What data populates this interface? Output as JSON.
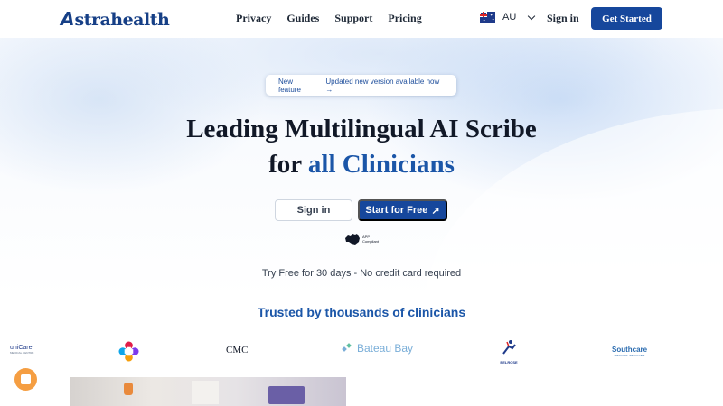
{
  "nav": {
    "logo_mark": "A",
    "logo_text": "stra",
    "logo_text_bold": "health",
    "links": [
      "Privacy",
      "Guides",
      "Support",
      "Pricing"
    ],
    "locale": "AU",
    "signin": "Sign in",
    "cta": "Get Started"
  },
  "announcement": {
    "tag": "New feature",
    "message": "Updated new version available now →"
  },
  "hero": {
    "line1": "Leading Multilingual AI Scribe",
    "line2_prefix": "for ",
    "line2_accent": "all Clinicians",
    "signin_button": "Sign in",
    "start_button": "Start for Free",
    "start_icon": "↗",
    "app_badge_line1": "APP",
    "app_badge_line2": "Compliant",
    "trial_note": "Try Free for 30 days - No credit card required"
  },
  "trusted": {
    "heading": "Trusted by thousands of clinicians",
    "logos": {
      "unicare": "uniCare",
      "unicare_sub": "MEDICAL CENTRE",
      "cmc": "CMC",
      "bateau": "Bateau Bay",
      "belrose": "BELROSE",
      "southcare": "Southcare",
      "southcare_sub": "MEDICAL SERVICES"
    }
  },
  "colors": {
    "brand": "#163f86",
    "accent": "#1b56a8",
    "chat": "#f59e42"
  }
}
